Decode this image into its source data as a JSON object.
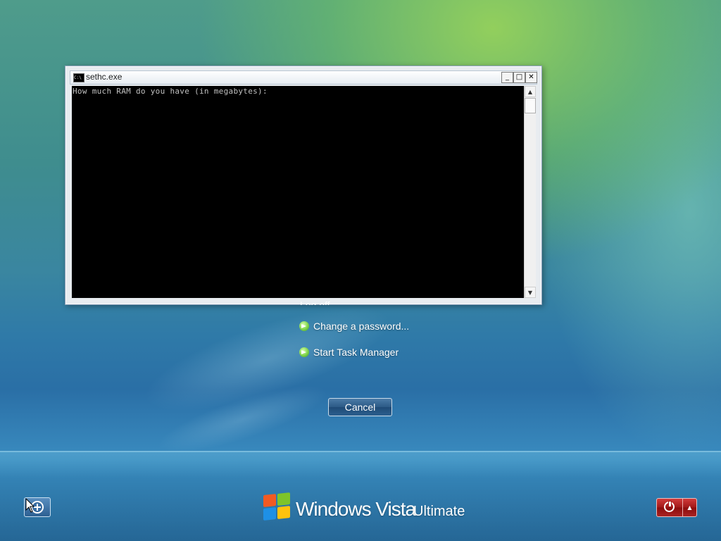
{
  "console_window": {
    "title": "sethc.exe",
    "icon": "console-icon",
    "minimize_label": "_",
    "maximize_label": "□",
    "close_label": "✕",
    "output_text": "How much RAM do you have (in megabytes):"
  },
  "options": {
    "partial_label": "Log off",
    "items": [
      {
        "label": "Change a password...",
        "icon": "green-arrow-icon"
      },
      {
        "label": "Start Task Manager",
        "icon": "green-arrow-icon"
      }
    ]
  },
  "cancel_button": {
    "label": "Cancel"
  },
  "branding": {
    "product": "Windows Vista",
    "edition": "Ultimate"
  },
  "colors": {
    "accent_green": "#7fd44a",
    "power_red": "#a01818"
  }
}
